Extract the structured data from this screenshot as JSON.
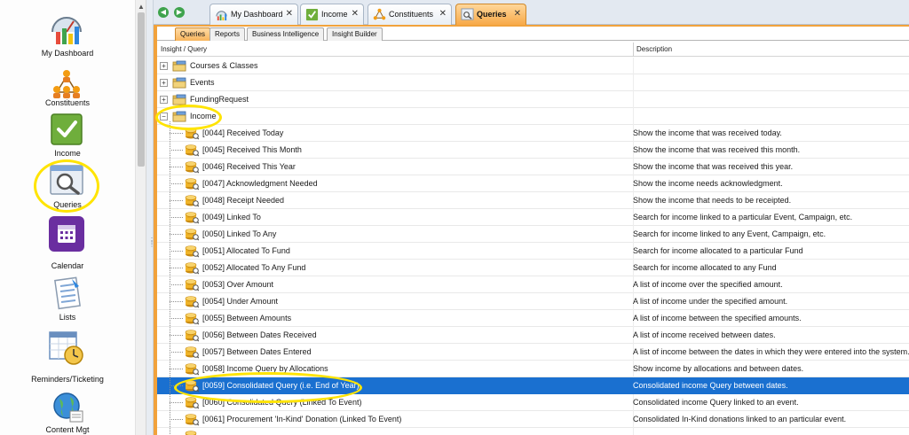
{
  "nav": {
    "items": [
      {
        "label": "My Dashboard",
        "icon": "dashboard-icon"
      },
      {
        "label": "Constituents",
        "icon": "constituents-icon"
      },
      {
        "label": "Income",
        "icon": "income-check-icon"
      },
      {
        "label": "Queries",
        "icon": "queries-magnifier-icon"
      },
      {
        "label": "Calendar",
        "icon": "calendar-icon"
      },
      {
        "label": "Lists",
        "icon": "lists-icon"
      },
      {
        "label": "Reminders/Ticketing",
        "icon": "reminders-clock-icon"
      },
      {
        "label": "Content Mgt",
        "icon": "content-mgt-globe-icon"
      }
    ]
  },
  "doc_tabs": [
    {
      "label": "My Dashboard",
      "close": "✕"
    },
    {
      "label": "Income",
      "close": "✕"
    },
    {
      "label": "Constituents",
      "close": "✕"
    },
    {
      "label": "Queries",
      "close": "✕"
    }
  ],
  "sub_tabs": [
    "Queries",
    "Reports",
    "Business Intelligence",
    "Insight Builder"
  ],
  "grid": {
    "columns": [
      "Insight / Query",
      "Description"
    ],
    "folders": [
      {
        "label": "Courses & Classes",
        "expander": "+"
      },
      {
        "label": "Events",
        "expander": "+"
      },
      {
        "label": "FundingRequest",
        "expander": "+"
      },
      {
        "label": "Income",
        "expander": "−"
      }
    ],
    "queries": [
      {
        "label": "[0044] Received Today",
        "desc": "Show the income that was received today."
      },
      {
        "label": "[0045] Received This Month",
        "desc": "Show the income that was received this month."
      },
      {
        "label": "[0046] Received This Year",
        "desc": "Show the income that was received this year."
      },
      {
        "label": "[0047] Acknowledgment Needed",
        "desc": "Show the income needs acknowledgment."
      },
      {
        "label": "[0048] Receipt Needed",
        "desc": "Show the income that needs to be receipted."
      },
      {
        "label": "[0049] Linked To",
        "desc": "Search for income linked to a particular Event, Campaign, etc."
      },
      {
        "label": "[0050] Linked To Any",
        "desc": "Search for income linked to any Event, Campaign, etc."
      },
      {
        "label": "[0051] Allocated To Fund",
        "desc": "Search for income allocated to a particular Fund"
      },
      {
        "label": "[0052] Allocated To Any Fund",
        "desc": "Search for income allocated to any Fund"
      },
      {
        "label": "[0053] Over Amount",
        "desc": "A list of income over the specified amount."
      },
      {
        "label": "[0054] Under Amount",
        "desc": "A list of income under the specified amount."
      },
      {
        "label": "[0055] Between Amounts",
        "desc": "A list of income between the specified amounts."
      },
      {
        "label": "[0056] Between Dates Received",
        "desc": "A list of income received between dates."
      },
      {
        "label": "[0057] Between Dates Entered",
        "desc": "A list of income between the dates in which they were entered into the system."
      },
      {
        "label": "[0058] Income Query by Allocations",
        "desc": "Show income by allocations and between dates."
      },
      {
        "label": "[0059] Consolidated Query (i.e. End of Year)",
        "desc": "Consolidated income Query between dates.",
        "selected": true
      },
      {
        "label": "[0060] Consolidated Query (Linked To Event)",
        "desc": "Consolidated income Query linked to an event."
      },
      {
        "label": "[0061] Procurement 'In-Kind' Donation (Linked To Event)",
        "desc": "Consolidated In-Kind donations linked to an particular event."
      },
      {
        "label": "",
        "desc": ""
      }
    ]
  },
  "colors": {
    "accent_orange": "#f1a23c",
    "selection_blue": "#1a70d0",
    "highlight_yellow": "#ffe400"
  }
}
